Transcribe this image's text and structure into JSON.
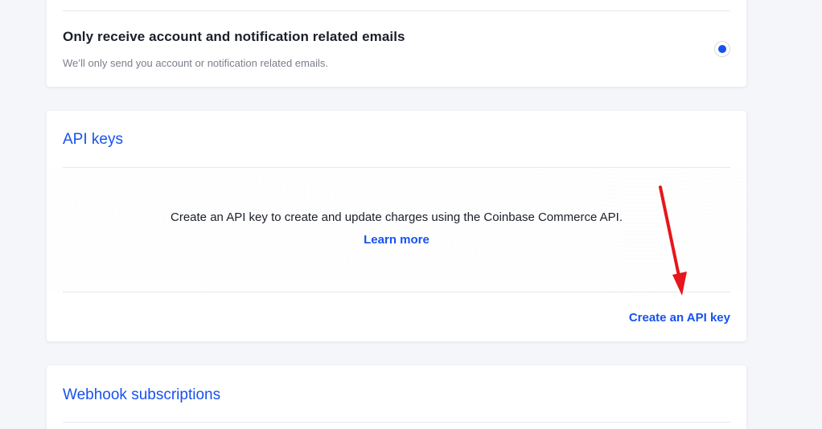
{
  "email_option": {
    "title": "Only receive account and notification related emails",
    "subtitle": "We’ll only send you account or notification related emails.",
    "selected": true
  },
  "api_keys": {
    "title": "API keys",
    "description": "Create an API key to create and update charges using the Coinbase Commerce API.",
    "learn_more": "Learn more",
    "create_button": "Create an API key"
  },
  "webhooks": {
    "title": "Webhook subscriptions"
  },
  "colors": {
    "accent": "#1652f0",
    "annotation_arrow": "#e5171c",
    "background": "#f5f6fa"
  },
  "annotation": {
    "icon": "red-arrow-icon"
  }
}
